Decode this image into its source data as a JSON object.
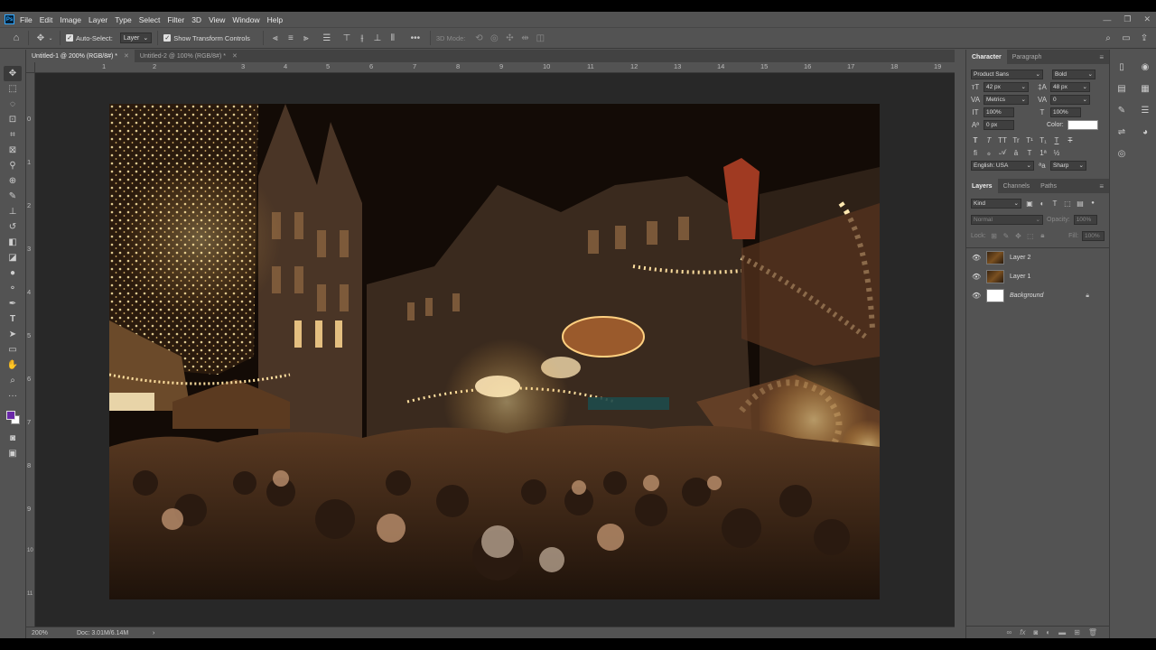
{
  "menus": [
    "File",
    "Edit",
    "Image",
    "Layer",
    "Type",
    "Select",
    "Filter",
    "3D",
    "View",
    "Window",
    "Help"
  ],
  "options": {
    "auto_select_label": "Auto-Select:",
    "auto_select_target": "Layer",
    "show_transform_label": "Show Transform Controls",
    "mode_3d_label": "3D Mode:",
    "more": "•••"
  },
  "tabs": [
    {
      "label": "Untitled-1 @ 200% (RGB/8#) *"
    },
    {
      "label": "Untitled-2 @ 100% (RGB/8#) *"
    }
  ],
  "ruler_h": [
    "1",
    "2",
    "3",
    "4",
    "5",
    "6",
    "7",
    "8",
    "9",
    "10",
    "11",
    "12",
    "13",
    "14",
    "15",
    "16",
    "17",
    "18",
    "19"
  ],
  "ruler_v": [
    "0",
    "1",
    "2",
    "3",
    "4",
    "5",
    "6",
    "7",
    "8",
    "9",
    "10",
    "11"
  ],
  "status": {
    "zoom": "200%",
    "doc": "Doc: 3.01M/6.14M",
    "arrow": "›"
  },
  "colors": {
    "foreground": "#6a28a8",
    "background": "#ffffff"
  },
  "character": {
    "tabs": [
      "Character",
      "Paragraph"
    ],
    "font_family": "Product Sans",
    "font_style": "Bold",
    "size": "42 px",
    "leading": "48 px",
    "kerning": "Metrics",
    "tracking": "0",
    "vscale": "100%",
    "hscale": "100%",
    "baseline": "0 px",
    "color_label": "Color:",
    "language": "English: USA",
    "aa_label": "ªa",
    "antialias": "Sharp",
    "type_buttons": [
      "T",
      "T",
      "TT",
      "Tr",
      "T¹",
      "T₁",
      "T",
      "T"
    ]
  },
  "layers": {
    "tabs": [
      "Layers",
      "Channels",
      "Paths"
    ],
    "filter": "Kind",
    "blend_mode": "Normal",
    "opacity_label": "Opacity:",
    "opacity": "100%",
    "lock_label": "Lock:",
    "fill_label": "Fill:",
    "fill": "100%",
    "items": [
      {
        "name": "Layer 2",
        "thumb": "photo",
        "italic": false,
        "locked": false
      },
      {
        "name": "Layer 1",
        "thumb": "photo",
        "italic": false,
        "locked": false
      },
      {
        "name": "Background",
        "thumb": "white",
        "italic": true,
        "locked": true
      }
    ]
  }
}
